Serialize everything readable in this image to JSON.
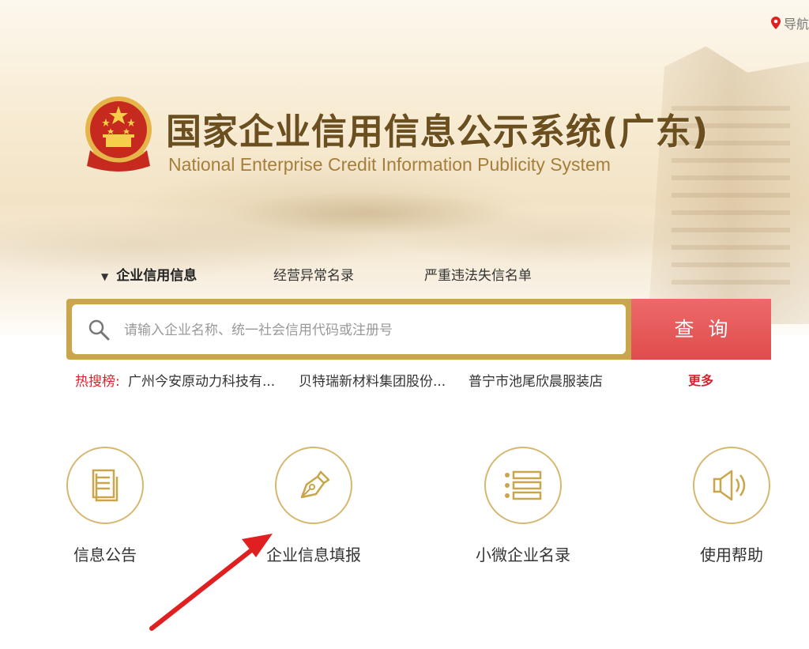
{
  "header": {
    "nav_label": "导航",
    "title_cn": "国家企业信用信息公示系统(广东)",
    "title_en": "National Enterprise Credit Information Publicity System"
  },
  "tabs": [
    {
      "label": "企业信用信息",
      "active": true
    },
    {
      "label": "经营异常名录",
      "active": false
    },
    {
      "label": "严重违法失信名单",
      "active": false
    }
  ],
  "search": {
    "placeholder": "请输入企业名称、统一社会信用代码或注册号",
    "value": "",
    "button_label": "查询"
  },
  "hot_search": {
    "label": "热搜榜:",
    "items": [
      "广州今安原动力科技有...",
      "贝特瑞新材料集团股份...",
      "普宁市池尾欣晨服装店"
    ],
    "more_label": "更多"
  },
  "features": [
    {
      "label": "信息公告",
      "icon": "document-icon"
    },
    {
      "label": "企业信息填报",
      "icon": "pen-icon"
    },
    {
      "label": "小微企业名录",
      "icon": "list-icon"
    },
    {
      "label": "使用帮助",
      "icon": "speaker-icon"
    }
  ],
  "colors": {
    "gold": "#c9a64b",
    "search_button": "#e14c4c",
    "accent_red": "#d9232e",
    "icon_gold": "#d6b770",
    "annotation_arrow": "#e02020"
  }
}
